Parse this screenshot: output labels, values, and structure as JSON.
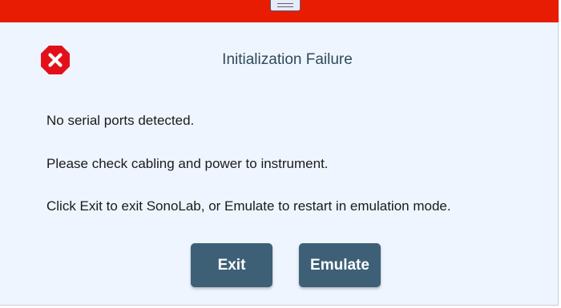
{
  "dialog": {
    "title": "Initialization Failure",
    "icon": "error-x-icon",
    "messages": [
      "No serial ports detected.",
      "Please check cabling and power to instrument.",
      "Click Exit to exit SonoLab, or Emulate to restart in emulation mode."
    ],
    "buttons": {
      "exit_label": "Exit",
      "emulate_label": "Emulate"
    }
  },
  "colors": {
    "titlebar": "#e81b03",
    "background": "#eef5fe",
    "button": "#3d6077",
    "icon": "#e3101a"
  }
}
